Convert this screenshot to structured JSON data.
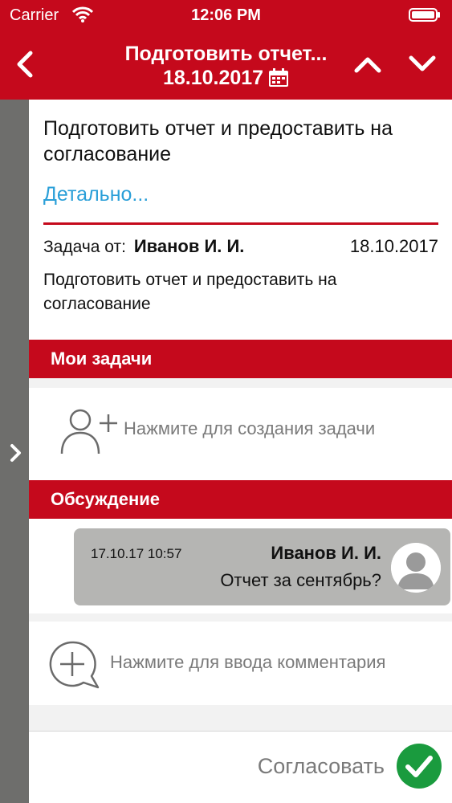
{
  "status_bar": {
    "carrier": "Carrier",
    "time": "12:06 PM"
  },
  "nav": {
    "title": "Подготовить отчет...",
    "date": "18.10.2017"
  },
  "task": {
    "title": "Подготовить отчет и предоставить на согласование",
    "details_link": "Детально...",
    "from_label": "Задача от:",
    "from_name": "Иванов И. И.",
    "from_date": "18.10.2017",
    "description": "Подготовить отчет и предоставить на согласование"
  },
  "sections": {
    "my_tasks": "Мои задачи",
    "discussion": "Обсуждение"
  },
  "create_task": {
    "hint": "Нажмите для создания задачи"
  },
  "message": {
    "time": "17.10.17 10:57",
    "author": "Иванов И. И.",
    "text": "Отчет за сентябрь?"
  },
  "comment": {
    "hint": "Нажмите для ввода комментария"
  },
  "approve": {
    "label": "Согласовать"
  },
  "colors": {
    "brand_red": "#c5091c",
    "link_blue": "#2a9fd8",
    "approve_green": "#1a9b3e",
    "rail_gray": "#6e6e6c"
  },
  "icons": [
    "wifi-icon",
    "battery-icon",
    "back-chevron-icon",
    "calendar-icon",
    "chevron-up-icon",
    "chevron-down-icon",
    "expand-chevron-icon",
    "add-person-icon",
    "avatar-icon",
    "add-comment-icon",
    "check-circle-icon"
  ]
}
